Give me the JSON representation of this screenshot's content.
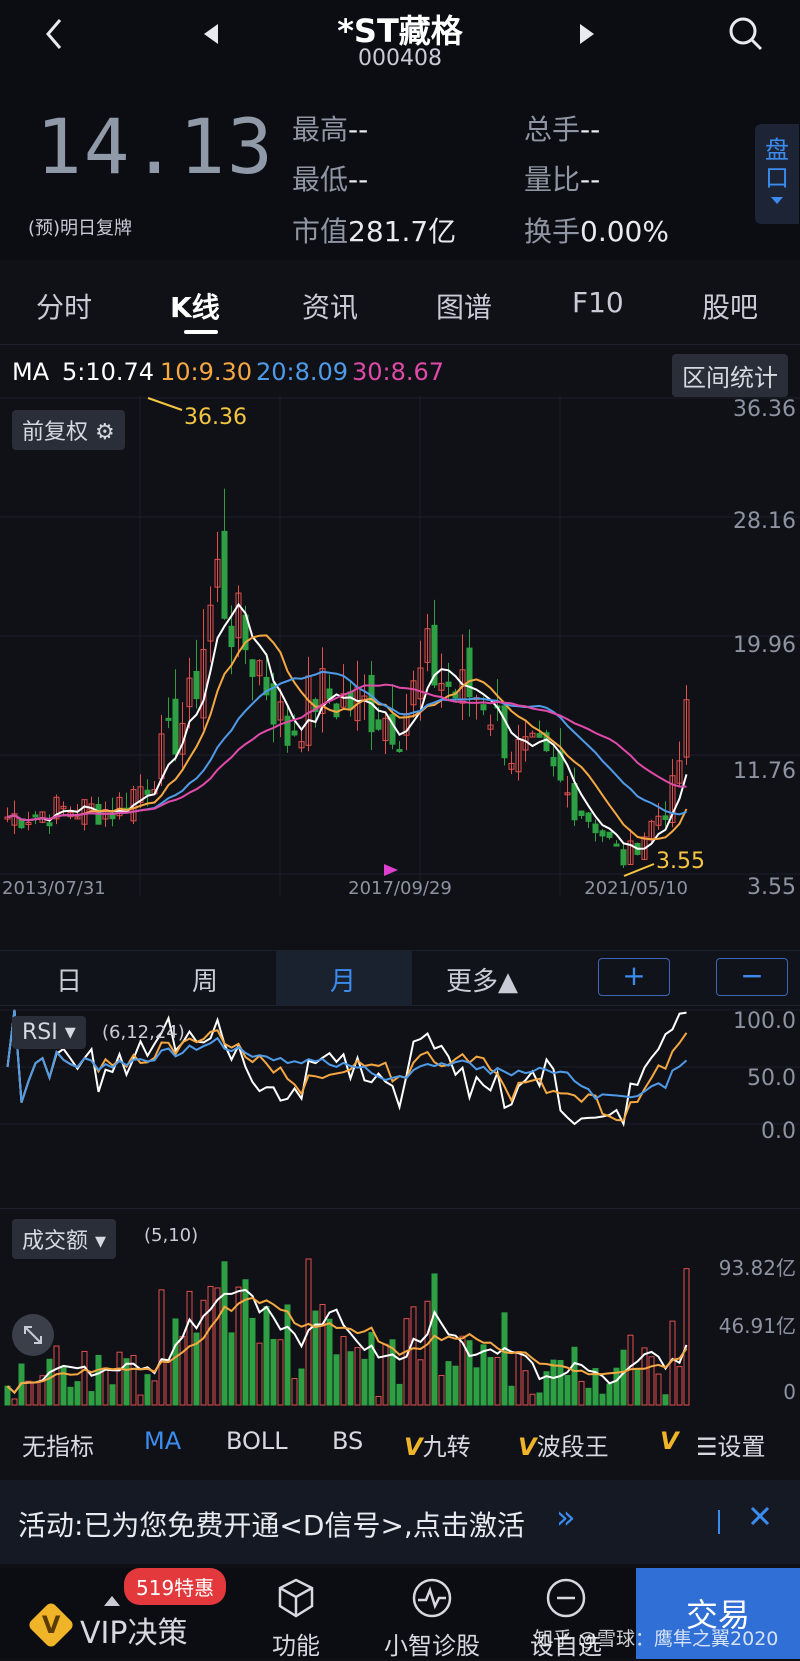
{
  "header": {
    "back_icon": "chevron-left-icon",
    "prev_icon": "triangle-left-icon",
    "next_icon": "triangle-right-icon",
    "search_icon": "search-icon",
    "name": "*ST藏格",
    "code": "000408",
    "price": "14.13",
    "price_note": "(预)明日复牌",
    "stats": {
      "high_label": "最高",
      "high_value": "--",
      "low_label": "最低",
      "low_value": "--",
      "mcap_label": "市值",
      "mcap_value": "281.7亿",
      "vol_label": "总手",
      "vol_value": "--",
      "ratio_label": "量比",
      "ratio_value": "--",
      "turnover_label": "换手",
      "turnover_value": "0.00%"
    },
    "pankou_label": "盘口"
  },
  "tabs": [
    "分时",
    "K线",
    "资讯",
    "图谱",
    "F10",
    "股吧"
  ],
  "ma": {
    "label": "MA",
    "ma5": "5:10.74",
    "ma10": "10:9.30",
    "ma20": "20:8.09",
    "ma30": "30:8.67",
    "interval_button": "区间统计",
    "colors": {
      "ma5": "#ffffff",
      "ma10": "#f5a742",
      "ma20": "#4f9be8",
      "ma30": "#e04aa8"
    }
  },
  "kline": {
    "adjust_label": "前复权",
    "y_ticks": [
      "36.36",
      "28.16",
      "19.96",
      "11.76",
      "3.55"
    ],
    "x_ticks": [
      "2013/07/31",
      "2017/09/29",
      "2021/05/10"
    ],
    "max_label": "36.36",
    "min_label": "3.55",
    "up_color": "#e0504c",
    "down_color": "#2ea043"
  },
  "periods": [
    "日",
    "周",
    "月",
    "更多▲"
  ],
  "period_plus": "+",
  "period_minus": "−",
  "rsi": {
    "label": "RSI",
    "params": "(6,12,24)",
    "y_ticks": [
      "100.0",
      "50.0",
      "0.0"
    ]
  },
  "volume": {
    "label": "成交额",
    "params": "(5,10)",
    "y_ticks": [
      "93.82亿",
      "46.91亿",
      "0"
    ]
  },
  "indicators": [
    "无指标",
    "MA",
    "BOLL",
    "BS",
    "九转",
    "波段王"
  ],
  "indicator_settings": "设置",
  "promo": {
    "text": "活动:已为您免费开通<D信号>,点击激活",
    "arrow": "»",
    "close_icon": "close-icon"
  },
  "bottom_nav": {
    "vip_label": "VIP决策",
    "vip_badge": "519特惠",
    "func_label": "功能",
    "diag_label": "小智诊股",
    "self_label": "设自选",
    "trade_label": "交易",
    "watermark": "知乎 @雪球：鹰隼之翼2020"
  }
}
